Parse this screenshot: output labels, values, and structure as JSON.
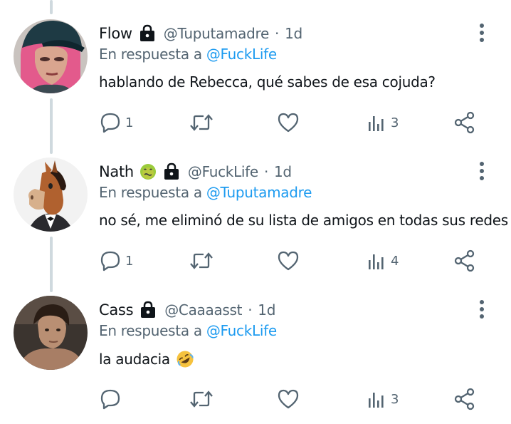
{
  "colors": {
    "link": "#1d9bf0",
    "secondary_text": "#536471",
    "primary_text": "#0f1419",
    "thread_line": "#cfd9de"
  },
  "replying_label": "En respuesta a",
  "tweets": [
    {
      "name": "Flow",
      "has_emoji": false,
      "handle": "@Tuputamadre",
      "separator": "·",
      "time": "1d",
      "reply_to": "@FuckLife",
      "text": "hablando de Rebecca, qué sabes de esa cojuda?",
      "text_emoji": "",
      "replies": "1",
      "retweets": "",
      "likes": "",
      "views": "3",
      "avatar": "pink-haired-character-avatar"
    },
    {
      "name": "Nath",
      "name_emoji": "nauseated-face-emoji",
      "handle": "@FuckLife",
      "separator": "·",
      "time": "1d",
      "reply_to": "@Tuputamadre",
      "text": "no sé, me eliminó de su lista de amigos en todas sus redes",
      "text_emoji": "",
      "replies": "1",
      "retweets": "",
      "likes": "",
      "views": "4",
      "avatar": "horse-character-avatar"
    },
    {
      "name": "Cass",
      "has_emoji": false,
      "handle": "@Caaaasst",
      "separator": "·",
      "time": "1d",
      "reply_to": "@FuckLife",
      "text": "la audacia",
      "text_emoji": "rolling-on-floor-laughing-emoji",
      "replies": "",
      "retweets": "",
      "likes": "",
      "views": "3",
      "avatar": "man-photo-avatar"
    }
  ],
  "icons": {
    "lock": "lock-icon",
    "more": "more-vertical-icon",
    "reply": "reply-icon",
    "retweet": "retweet-icon",
    "like": "heart-icon",
    "views": "views-icon",
    "share": "share-icon"
  }
}
